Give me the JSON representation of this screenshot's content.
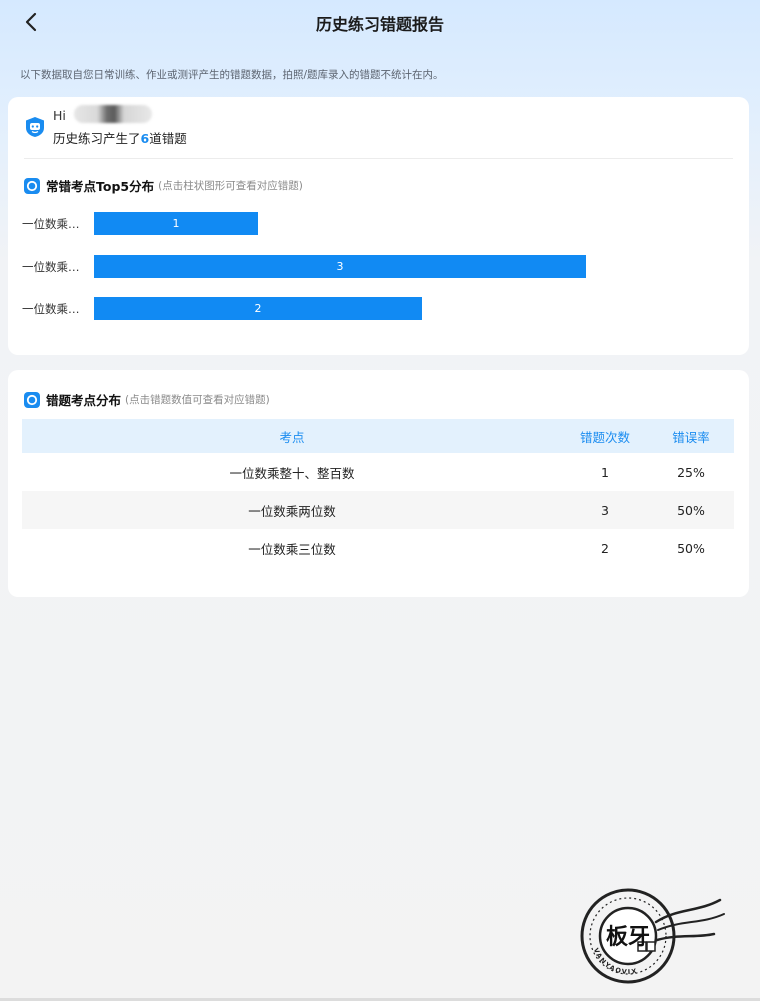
{
  "header": {
    "title": "历史练习错题报告",
    "back_icon": "chevron-left-icon"
  },
  "notice": "以下数据取自您日常训练、作业或测评产生的错题数据，拍照/题库录入的错题不统计在内。",
  "user": {
    "greeting": "Hi",
    "summary_prefix": "历史练习产生了",
    "wrong_count": "6",
    "summary_suffix": "道错题"
  },
  "top5": {
    "title": "常错考点Top5分布",
    "hint": "(点击柱状图形可查看对应错题)"
  },
  "chart_data": {
    "type": "bar",
    "orientation": "horizontal",
    "categories": [
      "一位数乘…",
      "一位数乘…",
      "一位数乘…"
    ],
    "values": [
      1,
      3,
      2
    ],
    "bar_color": "#118af3",
    "xlim": [
      0,
      3
    ]
  },
  "distribution": {
    "title": "错题考点分布",
    "hint": "(点击错题数值可查看对应错题)",
    "columns": [
      "考点",
      "错题次数",
      "错误率"
    ],
    "rows": [
      {
        "topic": "一位数乘整十、整百数",
        "count": "1",
        "rate": "25%"
      },
      {
        "topic": "一位数乘两位数",
        "count": "3",
        "rate": "50%"
      },
      {
        "topic": "一位数乘三位数",
        "count": "2",
        "rate": "50%"
      }
    ]
  },
  "watermark": {
    "text": "板牙",
    "ring_text": "VANYAOVIX"
  },
  "colors": {
    "accent": "#1a8cf0",
    "bar": "#118af3",
    "table_header_bg": "#e3f1fd"
  }
}
